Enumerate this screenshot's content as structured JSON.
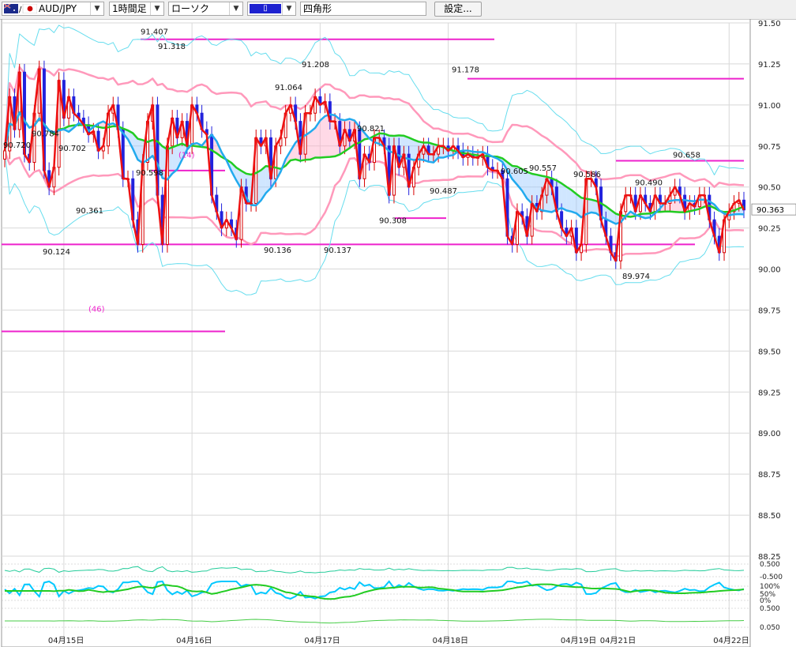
{
  "toolbar": {
    "symbol": "AUD/JPY",
    "timeframe": "1時間足",
    "chart_type": "ローソク",
    "color_mark": "▯",
    "shape": "四角形",
    "settings": "設定..."
  },
  "colors": {
    "up_candle": "#d80000",
    "down_candle": "#2222dd",
    "red_line": "#ee1111",
    "green_line": "#22cc22",
    "blue_line": "#22aaee",
    "pink_band": "#ff99bb",
    "cyan_band": "#66ddee",
    "magenta": "#ee22cc",
    "grid": "#d8d8d8"
  },
  "chart_data": {
    "type": "line",
    "symbol": "AUD/JPY",
    "y_ticks": [
      "91.50",
      "91.25",
      "91.00",
      "90.75",
      "90.50",
      "90.25",
      "90.00",
      "89.75",
      "89.50",
      "89.25",
      "89.00",
      "88.75",
      "88.50",
      "88.25"
    ],
    "ylim": [
      88.25,
      91.5
    ],
    "x_ticks": [
      "04月15日",
      "04月16日",
      "04月17日",
      "04月18日",
      "04月19日",
      "04月21日",
      "04月22日"
    ],
    "current_price": "90.363",
    "price_labels": [
      "91.407",
      "91.318",
      "91.208",
      "91.178",
      "91.064",
      "90.821",
      "90.784",
      "90.720",
      "90.702",
      "90.658",
      "90.605",
      "90.598",
      "90.586",
      "90.557",
      "90.487",
      "90.490",
      "90.361",
      "90.308",
      "90.136",
      "90.137",
      "90.124",
      "89.974"
    ],
    "annotations": [
      "(14)",
      "(46)"
    ],
    "series": [
      {
        "values": [
          90.72,
          91.05,
          90.85,
          91.2,
          90.7,
          90.65,
          90.95,
          91.22,
          90.6,
          90.5,
          90.62,
          91.15,
          90.92,
          91.05,
          90.95,
          90.92,
          90.88,
          90.82,
          90.84,
          90.72,
          90.75,
          90.95,
          91.0,
          90.85,
          90.55,
          90.55,
          90.3,
          90.15,
          90.65,
          90.9,
          91.0,
          90.45,
          90.15,
          90.75,
          90.92,
          90.8,
          90.9,
          90.75,
          91.0,
          90.95,
          90.85,
          90.82,
          90.45,
          90.35,
          90.25,
          90.3,
          90.25,
          90.18,
          90.5,
          90.4,
          90.4,
          90.8,
          90.75,
          90.8,
          90.55,
          90.75,
          90.8,
          90.95,
          91.0,
          90.9,
          90.7,
          90.95,
          90.95,
          91.05,
          91.0,
          91.02,
          90.9,
          90.9,
          90.75,
          90.85,
          90.78,
          90.85,
          90.55,
          90.7,
          90.65,
          90.8,
          90.8,
          90.75,
          90.45,
          90.75,
          90.62,
          90.7,
          90.5,
          90.62,
          90.7,
          90.75,
          90.7,
          90.7,
          90.75,
          90.75,
          90.72,
          90.75,
          90.72,
          90.68,
          90.7,
          90.68,
          90.68,
          90.7,
          90.62,
          90.6,
          90.6,
          90.55,
          90.2,
          90.15,
          90.35,
          90.32,
          90.2,
          90.4,
          90.35,
          90.45,
          90.55,
          90.5,
          90.35,
          90.25,
          90.2,
          90.25,
          90.1,
          90.15,
          90.55,
          90.55,
          90.5,
          90.3,
          90.2,
          90.1,
          90.05,
          90.35,
          90.45,
          90.45,
          90.35,
          90.45,
          90.4,
          90.35,
          90.45,
          90.4,
          90.4,
          90.45,
          90.5,
          90.45,
          90.35,
          90.4,
          90.38,
          90.45,
          90.45,
          90.3,
          90.2,
          90.1,
          90.3,
          90.35,
          90.4,
          90.42,
          90.36
        ]
      }
    ]
  }
}
